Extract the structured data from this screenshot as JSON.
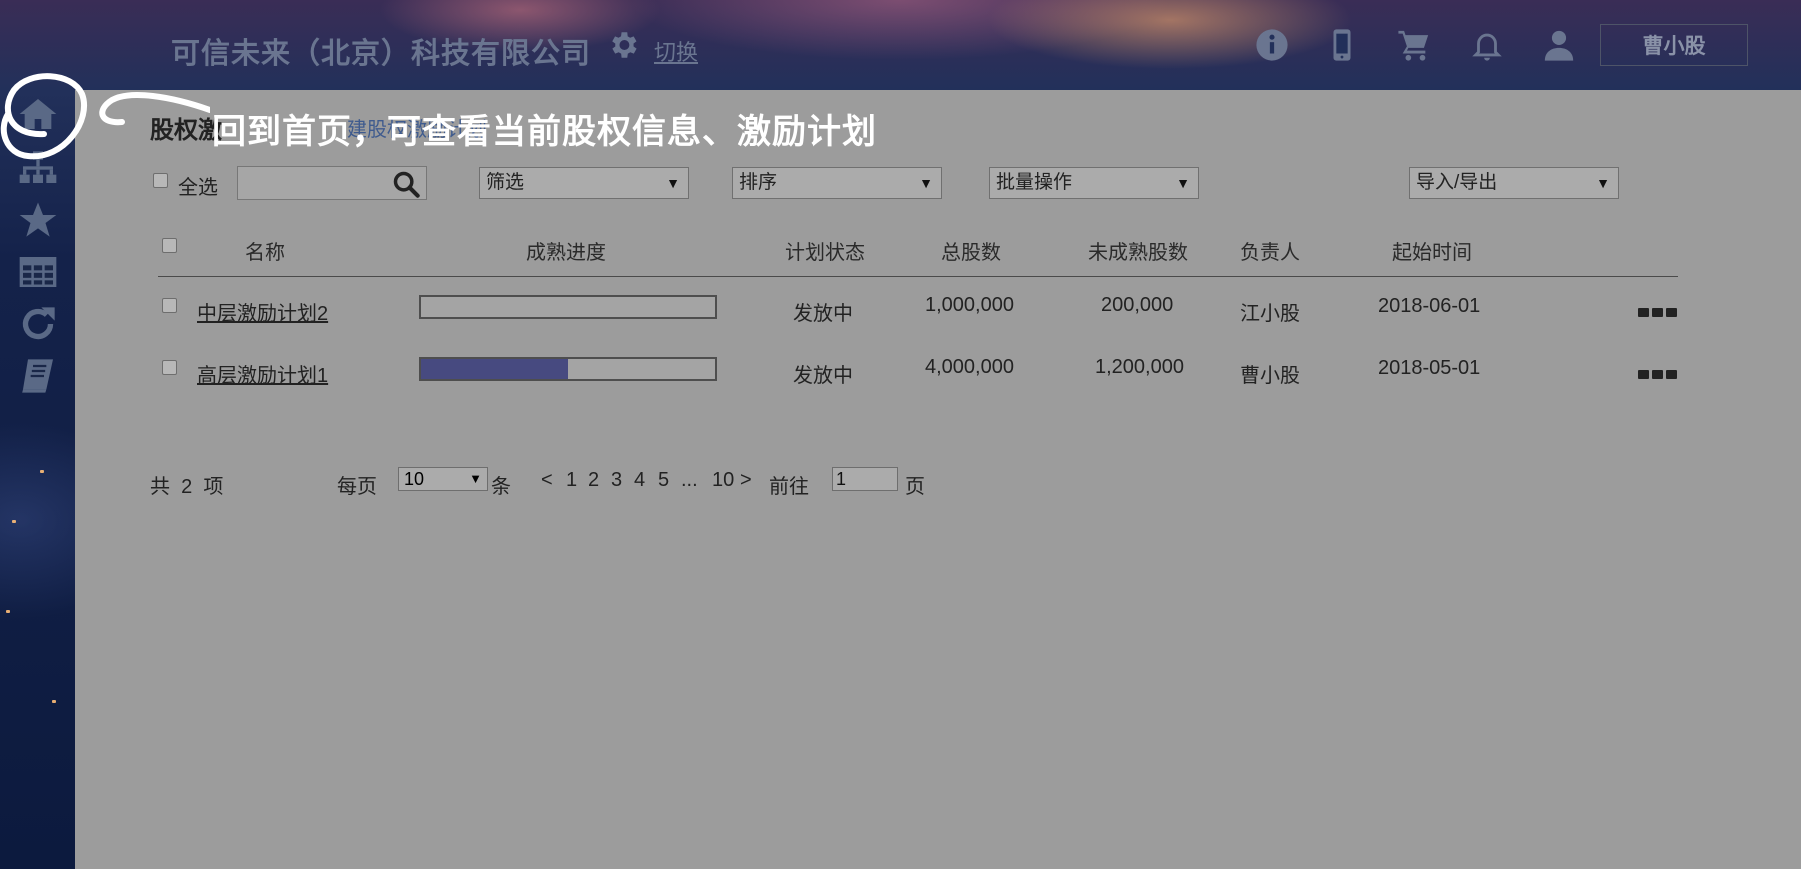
{
  "header": {
    "company_name": "可信未来（北京）科技有限公司",
    "switch_label": "切换",
    "user_name": "曹小股",
    "icons": [
      "info-icon",
      "mobile-icon",
      "cart-icon",
      "bell-icon",
      "user-icon"
    ]
  },
  "sidebar": {
    "items": [
      "home-icon",
      "org-chart-icon",
      "star-icon",
      "table-icon",
      "refresh-icon",
      "book-icon"
    ]
  },
  "page": {
    "title": "股权激",
    "title_link": "建股权激励计划"
  },
  "toolbar": {
    "select_all": "全选",
    "search_placeholder": "",
    "filter": "筛选",
    "sort": "排序",
    "batch": "批量操作",
    "import_export": "导入/导出"
  },
  "table": {
    "columns": [
      "名称",
      "成熟进度",
      "计划状态",
      "总股数",
      "未成熟股数",
      "负责人",
      "起始时间"
    ],
    "rows": [
      {
        "name": "中层激励计划2",
        "progress": 0.0,
        "status": "发放中",
        "total": "1,000,000",
        "unvested": "200,000",
        "owner": "江小股",
        "start": "2018-06-01"
      },
      {
        "name": "高层激励计划1",
        "progress": 0.5,
        "status": "发放中",
        "total": "4,000,000",
        "unvested": "1,200,000",
        "owner": "曹小股",
        "start": "2018-05-01"
      }
    ]
  },
  "pagination": {
    "total_text": "共  2  项",
    "per_page_label": "每页",
    "per_page_value": "10",
    "per_page_unit": "条",
    "prev": "<",
    "pages": [
      "1",
      "2",
      "3",
      "4",
      "5",
      "...",
      "10"
    ],
    "next": ">",
    "goto_label": "前往",
    "goto_value": "1",
    "goto_unit": "页"
  },
  "tour": {
    "text": "回到首页，可查看当前股权信息、激励计划"
  },
  "colors": {
    "overlay_panel": "#9c9c9c",
    "progress_fill": "#474a80",
    "tour_text": "#ffffff"
  }
}
